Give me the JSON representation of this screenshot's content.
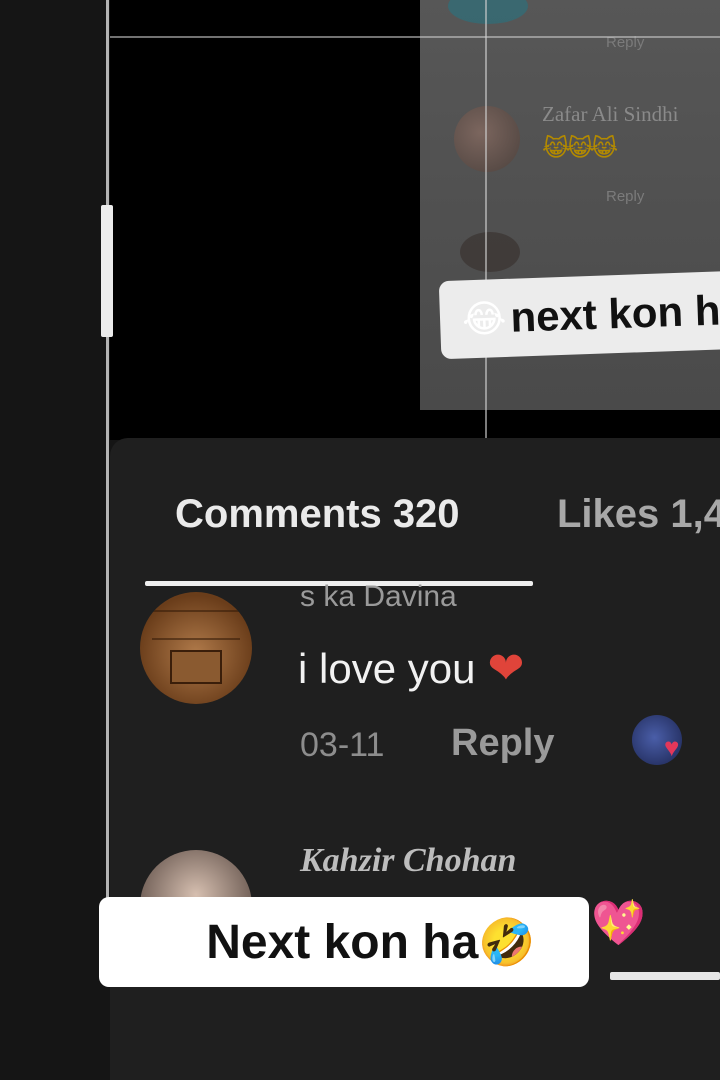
{
  "inner_screenshot": {
    "reply_top": "Reply",
    "username": "Zafar Ali Sindhi",
    "emojis": "😹😹😹",
    "reply_second": "Reply",
    "caption_emoji": "😂",
    "caption_text": "next kon h"
  },
  "tabs": {
    "comments": "Comments 320",
    "likes": "Likes 1,4"
  },
  "comments": [
    {
      "username": "s ka Davina",
      "text": "i love you",
      "emoji": "❤",
      "date": "03-11",
      "reply": "Reply"
    },
    {
      "username": "Kahzir Chohan",
      "emoji": "💖"
    }
  ],
  "caption": {
    "emoji_left": "😂",
    "text": "Next kon ha",
    "emoji_right": "🤣"
  },
  "colors": {
    "background": "#151515",
    "sheet": "#1f1f1f",
    "heart_red": "#e0443a",
    "caption_bg": "#ffffff"
  }
}
